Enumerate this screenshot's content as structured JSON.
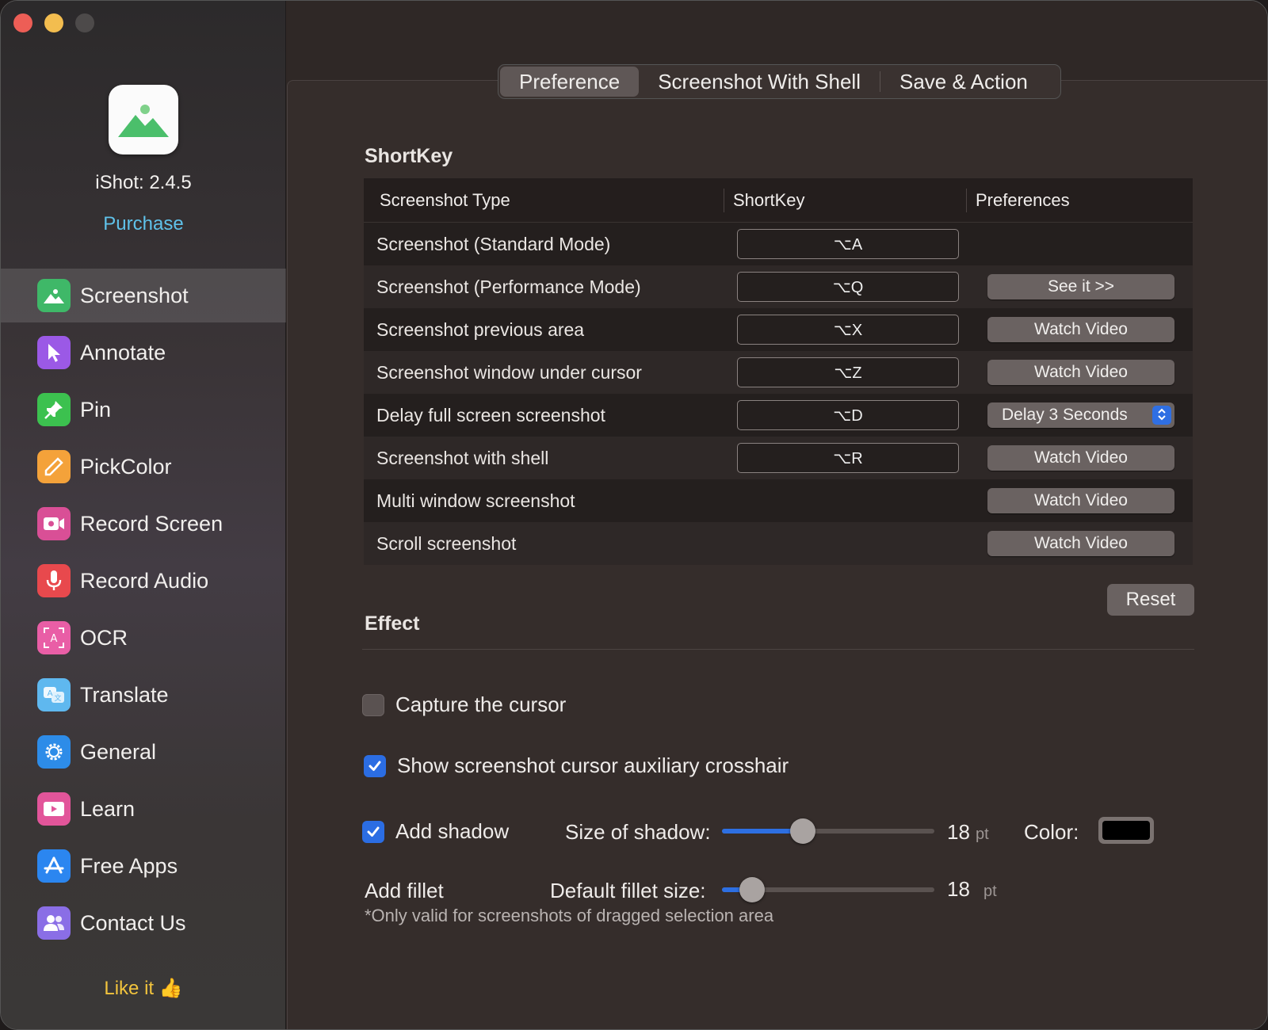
{
  "sidebar": {
    "app_version": "iShot: 2.4.5",
    "purchase": "Purchase",
    "items": [
      {
        "label": "Screenshot",
        "icon": "screenshot-icon",
        "color": "#3fb868",
        "active": true
      },
      {
        "label": "Annotate",
        "icon": "cursor-arrow-icon",
        "color": "#9b59e6"
      },
      {
        "label": "Pin",
        "icon": "pin-icon",
        "color": "#3cc14f"
      },
      {
        "label": "PickColor",
        "icon": "eyedropper-icon",
        "color": "#f4a23a"
      },
      {
        "label": "Record Screen",
        "icon": "video-camera-icon",
        "color": "#d94f96"
      },
      {
        "label": "Record Audio",
        "icon": "microphone-icon",
        "color": "#e8494d"
      },
      {
        "label": "OCR",
        "icon": "ocr-icon",
        "color": "#e95ea6"
      },
      {
        "label": "Translate",
        "icon": "translate-icon",
        "color": "#5fb8ef"
      },
      {
        "label": "General",
        "icon": "gear-icon",
        "color": "#2d8ce8"
      },
      {
        "label": "Learn",
        "icon": "film-icon",
        "color": "#e2559a"
      },
      {
        "label": "Free Apps",
        "icon": "app-store-icon",
        "color": "#2b86f0"
      },
      {
        "label": "Contact Us",
        "icon": "contacts-icon",
        "color": "#8a6ee6"
      }
    ],
    "like": "Like it 👍"
  },
  "tabs": [
    "Preference",
    "Screenshot With Shell",
    "Save & Action"
  ],
  "active_tab": "Preference",
  "shortkey": {
    "title": "ShortKey",
    "headers": [
      "Screenshot Type",
      "ShortKey",
      "Preferences"
    ],
    "rows": [
      {
        "type": "Screenshot (Standard Mode)",
        "key": "⌥A",
        "pref": ""
      },
      {
        "type": "Screenshot (Performance Mode)",
        "key": "⌥Q",
        "pref": "See it  >>"
      },
      {
        "type": "Screenshot previous area",
        "key": "⌥X",
        "pref": "Watch Video"
      },
      {
        "type": "Screenshot window under cursor",
        "key": "⌥Z",
        "pref": "Watch Video"
      },
      {
        "type": "Delay full screen screenshot",
        "key": "⌥D",
        "pref": "Delay 3 Seconds"
      },
      {
        "type": "Screenshot with shell",
        "key": "⌥R",
        "pref": "Watch Video"
      },
      {
        "type": "Multi window screenshot",
        "key": "",
        "pref": "Watch Video"
      },
      {
        "type": "Scroll screenshot",
        "key": "",
        "pref": "Watch Video"
      }
    ],
    "reset": "Reset"
  },
  "effect": {
    "title": "Effect",
    "capture_cursor": {
      "label": "Capture the cursor",
      "checked": false
    },
    "crosshair": {
      "label": "Show screenshot cursor auxiliary crosshair",
      "checked": true
    },
    "shadow": {
      "label": "Add shadow",
      "checked": true,
      "size_label": "Size of shadow:",
      "value": "18",
      "unit": "pt",
      "level": 0.38,
      "color_label": "Color:",
      "color": "#000000"
    },
    "fillet": {
      "label": "Add fillet",
      "size_label": "Default fillet size:",
      "value": "18",
      "unit": "pt",
      "level": 0.14,
      "note": "*Only valid for screenshots of dragged selection area"
    }
  }
}
